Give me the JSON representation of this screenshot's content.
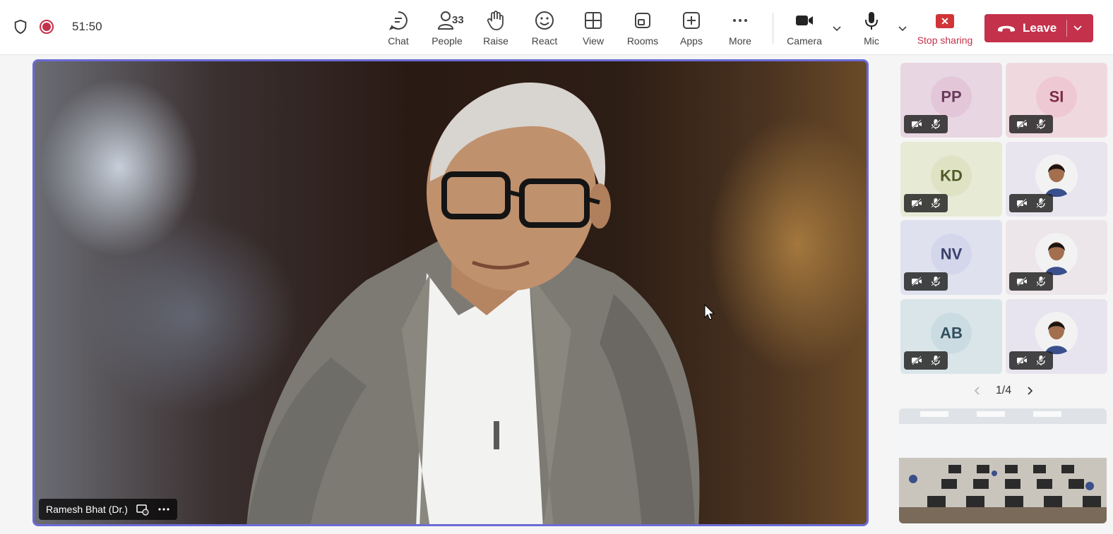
{
  "header": {
    "timer": "51:50",
    "tools": [
      {
        "id": "chat",
        "label": "Chat",
        "icon": "chat-icon"
      },
      {
        "id": "people",
        "label": "People",
        "icon": "people-icon",
        "count": "33"
      },
      {
        "id": "raise",
        "label": "Raise",
        "icon": "hand-icon"
      },
      {
        "id": "react",
        "label": "React",
        "icon": "smiley-icon"
      },
      {
        "id": "view",
        "label": "View",
        "icon": "grid-icon"
      },
      {
        "id": "rooms",
        "label": "Rooms",
        "icon": "rooms-icon"
      },
      {
        "id": "apps",
        "label": "Apps",
        "icon": "plus-square-icon"
      },
      {
        "id": "more",
        "label": "More",
        "icon": "ellipsis-icon"
      },
      {
        "id": "camera",
        "label": "Camera",
        "icon": "video-camera-icon"
      },
      {
        "id": "mic",
        "label": "Mic",
        "icon": "microphone-icon"
      }
    ],
    "stop_sharing": {
      "label": "Stop sharing",
      "glyph": "✕"
    },
    "leave": {
      "label": "Leave"
    }
  },
  "stage": {
    "speaker_name": "Ramesh Bhat (Dr.)"
  },
  "participants": [
    {
      "initials": "PP",
      "bg": "#e8d6e2",
      "avatar": "#e3c7d8",
      "fg": "#6b3b5c"
    },
    {
      "initials": "SI",
      "bg": "#efd9df",
      "avatar": "#eec8d2",
      "fg": "#7a2d45"
    },
    {
      "initials": "KD",
      "bg": "#e7ead5",
      "avatar": "#dfe3c4",
      "fg": "#4f5a2a"
    },
    {
      "initials": "",
      "bg": "#e9e5ef",
      "photo": true
    },
    {
      "initials": "NV",
      "bg": "#dfe1ee",
      "avatar": "#d4d7ec",
      "fg": "#3a3f6b"
    },
    {
      "initials": "",
      "bg": "#ece5ea",
      "photo": true
    },
    {
      "initials": "AB",
      "bg": "#dae5e9",
      "avatar": "#cbdbe2",
      "fg": "#2f4f5c"
    },
    {
      "initials": "",
      "bg": "#e8e4ef",
      "photo": true
    }
  ],
  "pager": {
    "label": "1/4"
  },
  "colors": {
    "accent": "#6b6bd6",
    "leave": "#c4314b",
    "stop": "#d13438"
  }
}
